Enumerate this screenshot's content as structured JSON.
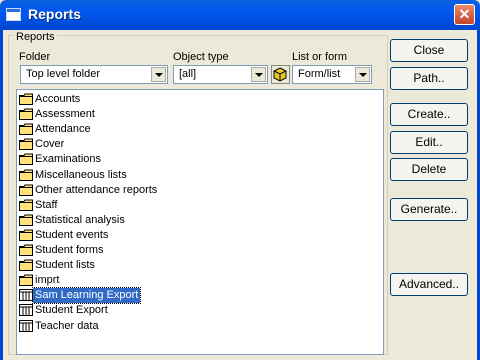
{
  "window": {
    "title": "Reports"
  },
  "groupbox": {
    "label": "Reports"
  },
  "folder": {
    "label": "Folder",
    "value": "Top level folder"
  },
  "object_type": {
    "label": "Object type",
    "value": "[all]"
  },
  "list_or_form": {
    "label": "List or form",
    "value": "Form/list"
  },
  "items": [
    {
      "label": "Accounts",
      "icon": "folder-icon"
    },
    {
      "label": "Assessment",
      "icon": "folder-icon"
    },
    {
      "label": "Attendance",
      "icon": "folder-icon"
    },
    {
      "label": "Cover",
      "icon": "folder-icon"
    },
    {
      "label": "Examinations",
      "icon": "folder-icon"
    },
    {
      "label": "Miscellaneous lists",
      "icon": "folder-icon"
    },
    {
      "label": "Other attendance reports",
      "icon": "folder-icon"
    },
    {
      "label": "Staff",
      "icon": "folder-icon"
    },
    {
      "label": "Statistical analysis",
      "icon": "folder-icon"
    },
    {
      "label": "Student events",
      "icon": "folder-icon"
    },
    {
      "label": "Student forms",
      "icon": "folder-icon"
    },
    {
      "label": "Student lists",
      "icon": "folder-icon"
    },
    {
      "label": "imprt",
      "icon": "folder-icon"
    },
    {
      "label": "Sam Learning Export",
      "icon": "report-icon",
      "selected": true
    },
    {
      "label": "Student Export",
      "icon": "report-icon"
    },
    {
      "label": "Teacher data",
      "icon": "report-icon"
    }
  ],
  "buttons": {
    "close": "Close",
    "path": "Path..",
    "create": "Create..",
    "edit": "Edit..",
    "delete": "Delete",
    "generate": "Generate..",
    "advanced": "Advanced.."
  },
  "colors": {
    "titlebar": "#0058ee",
    "selection": "#316ac5",
    "folder": "#ffe27a"
  }
}
